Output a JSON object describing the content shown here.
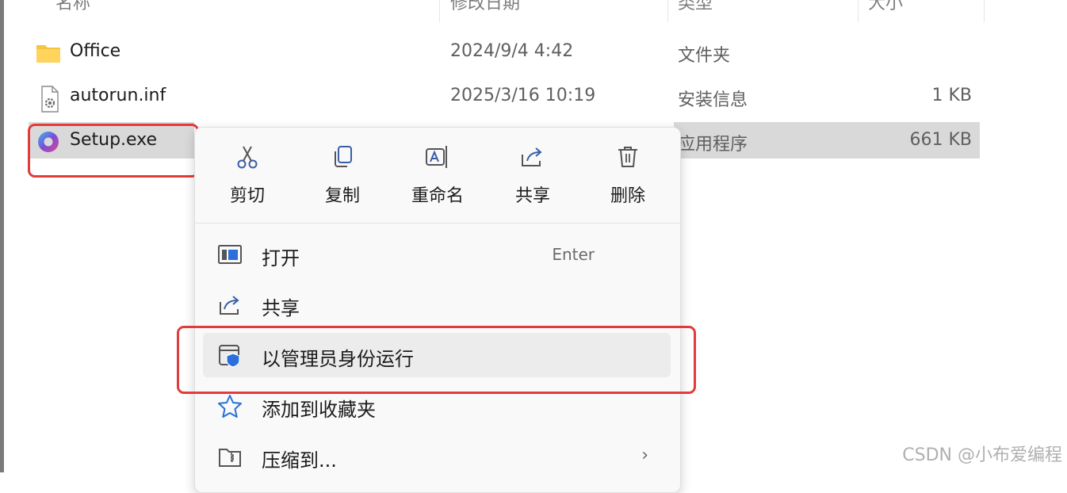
{
  "header": {
    "col_name": "名称",
    "col_date": "修改日期",
    "col_type": "类型",
    "col_size": "大小"
  },
  "files": [
    {
      "name": "Office",
      "date": "2024/9/4 4:42",
      "type": "文件夹",
      "size": "",
      "icon": "folder-icon"
    },
    {
      "name": "autorun.inf",
      "date": "2025/3/16 10:19",
      "type": "安装信息",
      "size": "1 KB",
      "icon": "settings-file-icon"
    },
    {
      "name": "Setup.exe",
      "date": "",
      "type": "应用程序",
      "size": "661 KB",
      "icon": "app-icon",
      "selected": true
    }
  ],
  "context_menu": {
    "quick_actions": [
      {
        "label": "剪切",
        "icon": "cut-icon"
      },
      {
        "label": "复制",
        "icon": "copy-icon"
      },
      {
        "label": "重命名",
        "icon": "rename-icon"
      },
      {
        "label": "共享",
        "icon": "share-icon"
      },
      {
        "label": "删除",
        "icon": "delete-icon"
      }
    ],
    "items": [
      {
        "label": "打开",
        "accelerator": "Enter",
        "icon": "open-icon"
      },
      {
        "label": "共享",
        "icon": "share-icon"
      },
      {
        "label": "以管理员身份运行",
        "icon": "shield-icon",
        "highlighted": true
      },
      {
        "label": "添加到收藏夹",
        "icon": "star-icon"
      },
      {
        "label": "压缩到...",
        "icon": "zip-folder-icon",
        "submenu": true
      }
    ],
    "submenu_glyph": "›"
  },
  "colors": {
    "highlight_red": "#e23b3b",
    "selection_gray": "#d9d9d9",
    "folder_yellow": "#f4c542",
    "accent_blue": "#2a6fdb"
  },
  "watermark": "CSDN @小布爱编程"
}
